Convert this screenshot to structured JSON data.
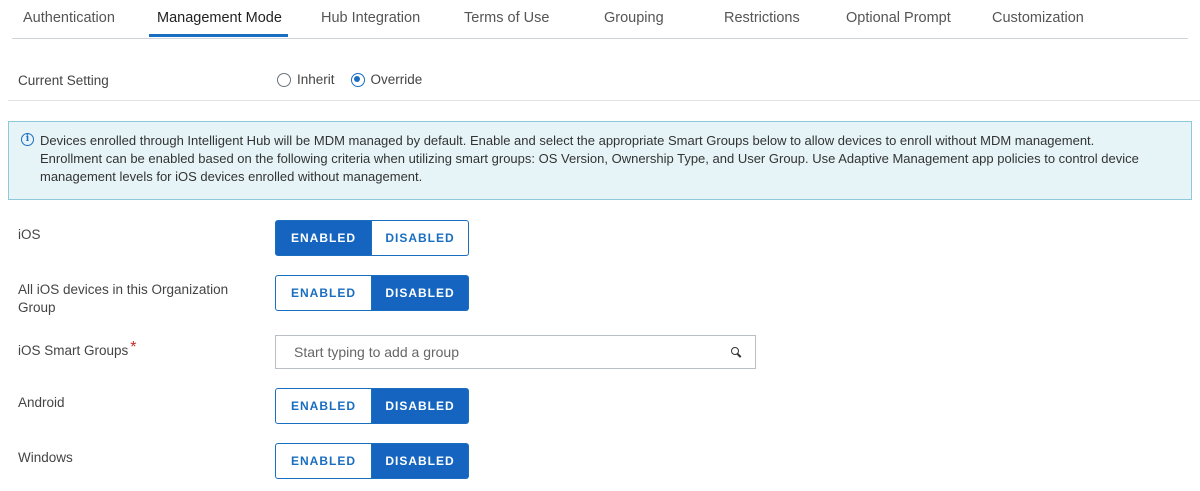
{
  "tabs": [
    {
      "label": "Authentication",
      "active": false
    },
    {
      "label": "Management Mode",
      "active": true
    },
    {
      "label": "Hub Integration",
      "active": false
    },
    {
      "label": "Terms of Use",
      "active": false
    },
    {
      "label": "Grouping",
      "active": false
    },
    {
      "label": "Restrictions",
      "active": false
    },
    {
      "label": "Optional Prompt",
      "active": false
    },
    {
      "label": "Customization",
      "active": false
    }
  ],
  "current_setting": {
    "label": "Current Setting",
    "options": [
      "Inherit",
      "Override"
    ],
    "selected": "Override"
  },
  "info": {
    "icon": "info-icon",
    "line1": "Devices enrolled through Intelligent Hub will be MDM managed by default. Enable and select the appropriate Smart Groups below to allow devices to enroll without MDM management.",
    "line2": "Enrollment can be enabled based on the following criteria when utilizing smart groups: OS Version, Ownership Type, and User Group. Use Adaptive Management app policies to control device",
    "line3": "management levels for iOS devices enrolled without management."
  },
  "toggle_labels": {
    "enabled": "ENABLED",
    "disabled": "DISABLED"
  },
  "settings": {
    "ios": {
      "label": "iOS",
      "value": "ENABLED"
    },
    "all_ios_devices": {
      "label": "All iOS devices in this Organization Group",
      "value": "DISABLED"
    },
    "ios_smart_groups": {
      "label": "iOS Smart Groups",
      "required_mark": "*",
      "placeholder": "Start typing to add a group",
      "value": ""
    },
    "android": {
      "label": "Android",
      "value": "DISABLED"
    },
    "windows": {
      "label": "Windows",
      "value": "DISABLED"
    }
  },
  "colors": {
    "accent": "#1565c0",
    "info_bg": "#e6f4f8",
    "info_border": "#8ec9db",
    "required": "#c92a2a"
  }
}
